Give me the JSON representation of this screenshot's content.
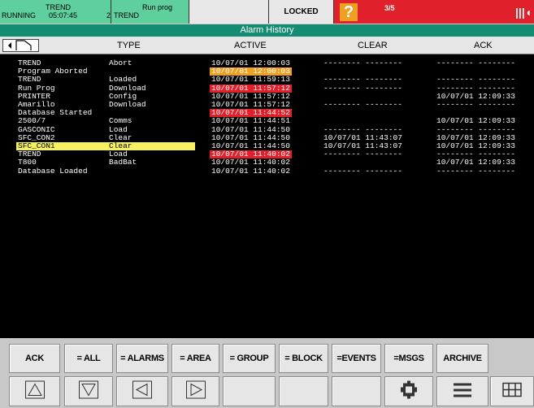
{
  "status": {
    "trend_label": "TREND",
    "running": "RUNNING",
    "time": "05:07:45",
    "prog_label": "Run prog",
    "prog_num": "2",
    "prog_value": "TREND",
    "locked": "LOCKED",
    "alarm_count": "3/5",
    "help_icon": "question-icon",
    "bell_icon": "alarm-bell-icon",
    "alarm_color": "#e0202a",
    "ok_color": "#5fcf9e"
  },
  "title": "Alarm History",
  "columns": {
    "type": "TYPE",
    "active": "ACTIVE",
    "clear": "CLEAR",
    "ack": "ACK"
  },
  "rows": [
    {
      "name": "TREND",
      "type": "Abort",
      "active": "10/07/01 12:00:03",
      "clear": "-------- --------",
      "ack": "-------- --------",
      "hl": ""
    },
    {
      "name": "Program Aborted",
      "type": "",
      "active": "10/07/01 12:00:03",
      "clear": "",
      "ack": "",
      "hl": "orange"
    },
    {
      "name": "TREND",
      "type": "Loaded",
      "active": "10/07/01 11:59:13",
      "clear": "-------- --------",
      "ack": "-------- --------",
      "hl": ""
    },
    {
      "name": "Run Prog",
      "type": "Download",
      "active": "10/07/01 11:57:12",
      "clear": "-------- --------",
      "ack": "-------- --------",
      "hl": "red"
    },
    {
      "name": "PRINTER",
      "type": "Config",
      "active": "10/07/01 11:57:12",
      "clear": "",
      "ack": "10/07/01 12:09:33",
      "hl": ""
    },
    {
      "name": "Amarillo",
      "type": "Download",
      "active": "10/07/01 11:57:12",
      "clear": "-------- --------",
      "ack": "-------- --------",
      "hl": ""
    },
    {
      "name": "Database Started",
      "type": "",
      "active": "10/07/01 11:44:52",
      "clear": "",
      "ack": "",
      "hl": "red"
    },
    {
      "name": "2500/7",
      "type": "Comms",
      "active": "10/07/01 11:44:51",
      "clear": "",
      "ack": "10/07/01 12:09:33",
      "hl": ""
    },
    {
      "name": "GASCONIC",
      "type": "Load",
      "active": "10/07/01 11:44:50",
      "clear": "-------- --------",
      "ack": "-------- --------",
      "hl": ""
    },
    {
      "name": "SFC_CON2",
      "type": "Clear",
      "active": "10/07/01 11:44:50",
      "clear": "10/07/01 11:43:07",
      "ack": "10/07/01 12:09:33",
      "hl": ""
    },
    {
      "name": "SFC_CON1",
      "type": "Clear",
      "active": "10/07/01 11:44:50",
      "clear": "10/07/01 11:43:07",
      "ack": "10/07/01 12:09:33",
      "hl": "",
      "selected": true
    },
    {
      "name": "TREND",
      "type": "Load",
      "active": "10/07/01 11:40:02",
      "clear": "-------- --------",
      "ack": "-------- --------",
      "hl": "red"
    },
    {
      "name": "T800",
      "type": "BadBat",
      "active": "10/07/01 11:40:02",
      "clear": "",
      "ack": "10/07/01 12:09:33",
      "hl": ""
    },
    {
      "name": "Database Loaded",
      "type": "",
      "active": "10/07/01 11:40:02",
      "clear": "-------- --------",
      "ack": "-------- --------",
      "hl": ""
    }
  ],
  "function_buttons": [
    "ACK",
    "= ALL",
    "= ALARMS",
    "= AREA",
    "= GROUP",
    "= BLOCK",
    "=EVENTS",
    "=MSGS",
    "ARCHIVE"
  ],
  "nav_buttons": [
    {
      "icon": "scroll-up-icon"
    },
    {
      "icon": "scroll-down-icon"
    },
    {
      "icon": "scroll-left-icon"
    },
    {
      "icon": "scroll-right-icon"
    },
    {
      "icon": ""
    },
    {
      "icon": ""
    },
    {
      "icon": ""
    },
    {
      "icon": "overview-icon"
    },
    {
      "icon": "menu-icon"
    },
    {
      "icon": "grid-icon"
    }
  ],
  "highlight_colors": {
    "red": "#e0202a",
    "orange": "#f0a020",
    "selected": "#f6f060"
  }
}
